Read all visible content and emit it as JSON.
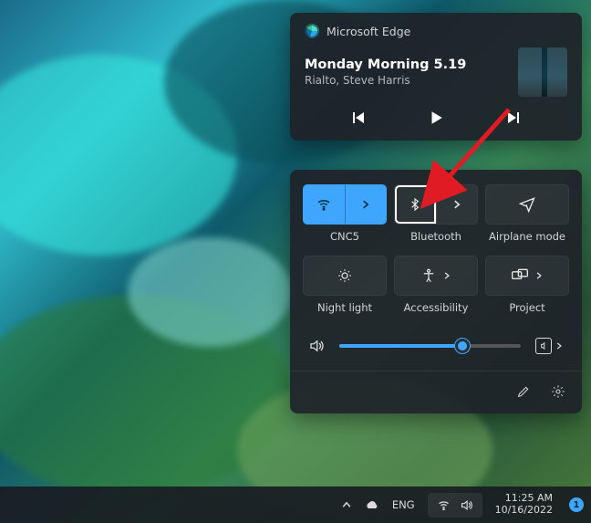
{
  "media": {
    "app": "Microsoft Edge",
    "title": "Monday Morning 5.19",
    "artist": "Rialto, Steve Harris"
  },
  "qs": {
    "tiles": {
      "wifi": {
        "label": "CNC5",
        "active": true
      },
      "bluetooth": {
        "label": "Bluetooth",
        "active": false,
        "focused": true
      },
      "airplane": {
        "label": "Airplane mode",
        "active": false
      },
      "nightlight": {
        "label": "Night light",
        "active": false
      },
      "accessibility": {
        "label": "Accessibility",
        "active": false
      },
      "project": {
        "label": "Project",
        "active": false
      }
    },
    "volume_percent": 68
  },
  "taskbar": {
    "lang": "ENG",
    "time": "11:25 AM",
    "date": "10/16/2022",
    "notif_count": "1"
  }
}
